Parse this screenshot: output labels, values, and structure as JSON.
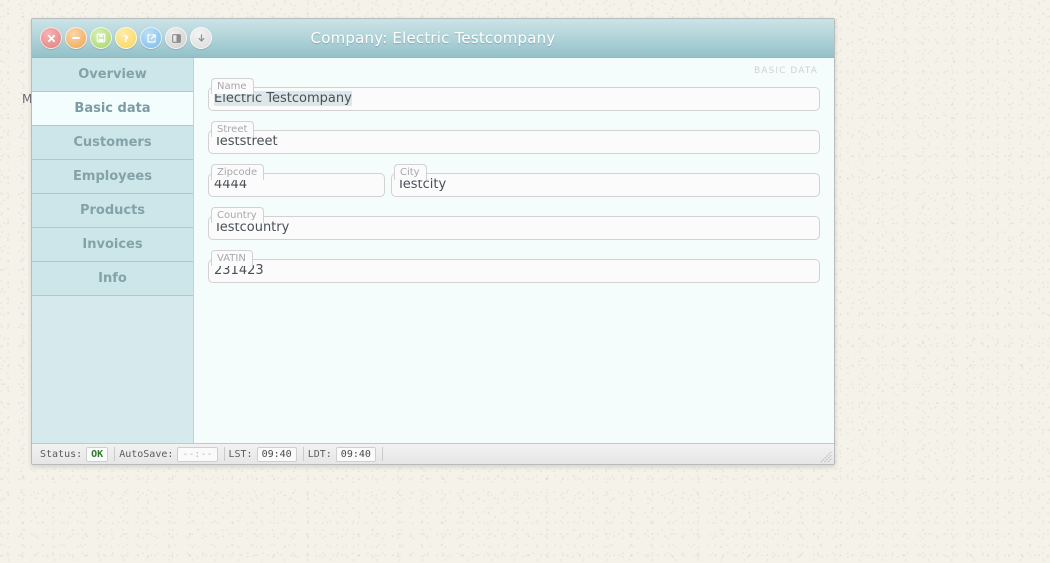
{
  "desktop": {
    "partial_label": "M"
  },
  "window": {
    "title": "Company: Electric Testcompany",
    "title_buttons": [
      {
        "name": "close-button",
        "icon": "close-icon",
        "glyph": "✕"
      },
      {
        "name": "minimize-button",
        "icon": "minimize-icon",
        "glyph": "−"
      },
      {
        "name": "save-button",
        "icon": "floppy-disk-icon",
        "glyph": "▣"
      },
      {
        "name": "help-button",
        "icon": "question-mark-icon",
        "glyph": "?"
      },
      {
        "name": "open-external-button",
        "icon": "external-link-icon",
        "glyph": "↗"
      },
      {
        "name": "duplicate-button",
        "icon": "copy-window-icon",
        "glyph": "▧"
      },
      {
        "name": "download-button",
        "icon": "download-arrow-icon",
        "glyph": "↓"
      }
    ]
  },
  "sidebar": {
    "items": [
      {
        "label": "Overview",
        "selected": false
      },
      {
        "label": "Basic data",
        "selected": true
      },
      {
        "label": "Customers",
        "selected": false
      },
      {
        "label": "Employees",
        "selected": false
      },
      {
        "label": "Products",
        "selected": false
      },
      {
        "label": "Invoices",
        "selected": false
      },
      {
        "label": "Info",
        "selected": false
      }
    ]
  },
  "content": {
    "section_label": "BASIC DATA",
    "fields": {
      "name": {
        "label": "Name",
        "value": "Electric Testcompany",
        "placeholder": "",
        "selected": true
      },
      "street": {
        "label": "Street",
        "value": "Teststreet",
        "placeholder": "",
        "selected": false
      },
      "zipcode": {
        "label": "Zipcode",
        "value": "4444",
        "placeholder": "",
        "selected": false
      },
      "city": {
        "label": "City",
        "value": "Testcity",
        "placeholder": "",
        "selected": false
      },
      "country": {
        "label": "Country",
        "value": "Testcountry",
        "placeholder": "",
        "selected": false
      },
      "vatin": {
        "label": "VATIN",
        "value": "231423",
        "placeholder": "",
        "selected": false
      }
    }
  },
  "statusbar": {
    "status_key": "Status:",
    "status_value": "OK",
    "autosave_key": "AutoSave:",
    "autosave_value": "--:--",
    "lst_key": "LST:",
    "lst_value": "09:40",
    "ldt_key": "LDT:",
    "ldt_value": "09:40"
  },
  "colors": {
    "titlebar_top": "#cbe3e7",
    "titlebar_bottom": "#93c1c8",
    "sidebar": "#cde6ea",
    "sidebar_selected": "#f4fdfd",
    "content_bg": "#f4fcfc",
    "status_ok": "#2d7d2d",
    "desktop_bg": "#f5f2ea"
  }
}
